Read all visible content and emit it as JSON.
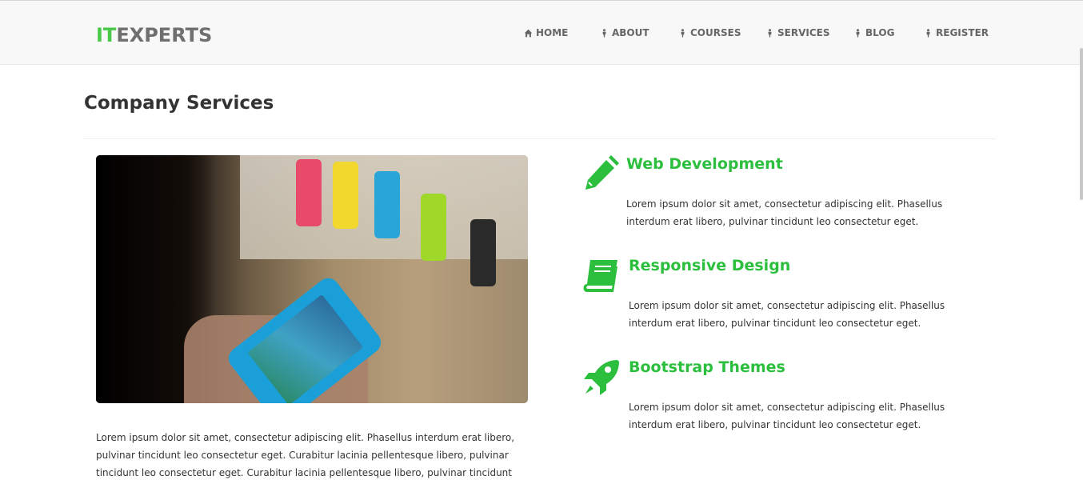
{
  "brand": {
    "prefix": "IT",
    "suffix": "EXPERTS",
    "accent_color": "#48c948"
  },
  "nav": {
    "items": [
      {
        "label": "HOME",
        "icon": "home-icon"
      },
      {
        "label": "ABOUT",
        "icon": "person-icon"
      },
      {
        "label": "COURSES",
        "icon": "person-icon"
      },
      {
        "label": "SERVICES",
        "icon": "person-icon"
      },
      {
        "label": "BLOG",
        "icon": "person-icon"
      },
      {
        "label": "REGISTER",
        "icon": "person-icon"
      }
    ]
  },
  "main": {
    "title": "Company Services",
    "image": {
      "alt": "Person holding a blue smartphone in a store"
    },
    "paragraph": "Lorem ipsum dolor sit amet, consectetur adipiscing elit. Phasellus interdum erat libero, pulvinar tincidunt leo consectetur eget. Curabitur lacinia pellentesque libero, pulvinar tincidunt leo consectetur eget. Curabitur lacinia pellentesque libero, pulvinar tincidunt leo"
  },
  "services": [
    {
      "title": "Web Development",
      "icon": "pencil-icon",
      "description": "Lorem ipsum dolor sit amet, consectetur adipiscing elit. Phasellus interdum erat libero, pulvinar tincidunt leo consectetur eget."
    },
    {
      "title": "Responsive Design",
      "icon": "book-icon",
      "description": "Lorem ipsum dolor sit amet, consectetur adipiscing elit. Phasellus interdum erat libero, pulvinar tincidunt leo consectetur eget."
    },
    {
      "title": "Bootstrap Themes",
      "icon": "rocket-icon",
      "description": "Lorem ipsum dolor sit amet, consectetur adipiscing elit. Phasellus interdum erat libero, pulvinar tincidunt leo consectetur eget."
    }
  ],
  "colors": {
    "service_accent": "#2bbf3d",
    "nav_text": "#666666",
    "navbar_bg": "#f8f8f8"
  }
}
